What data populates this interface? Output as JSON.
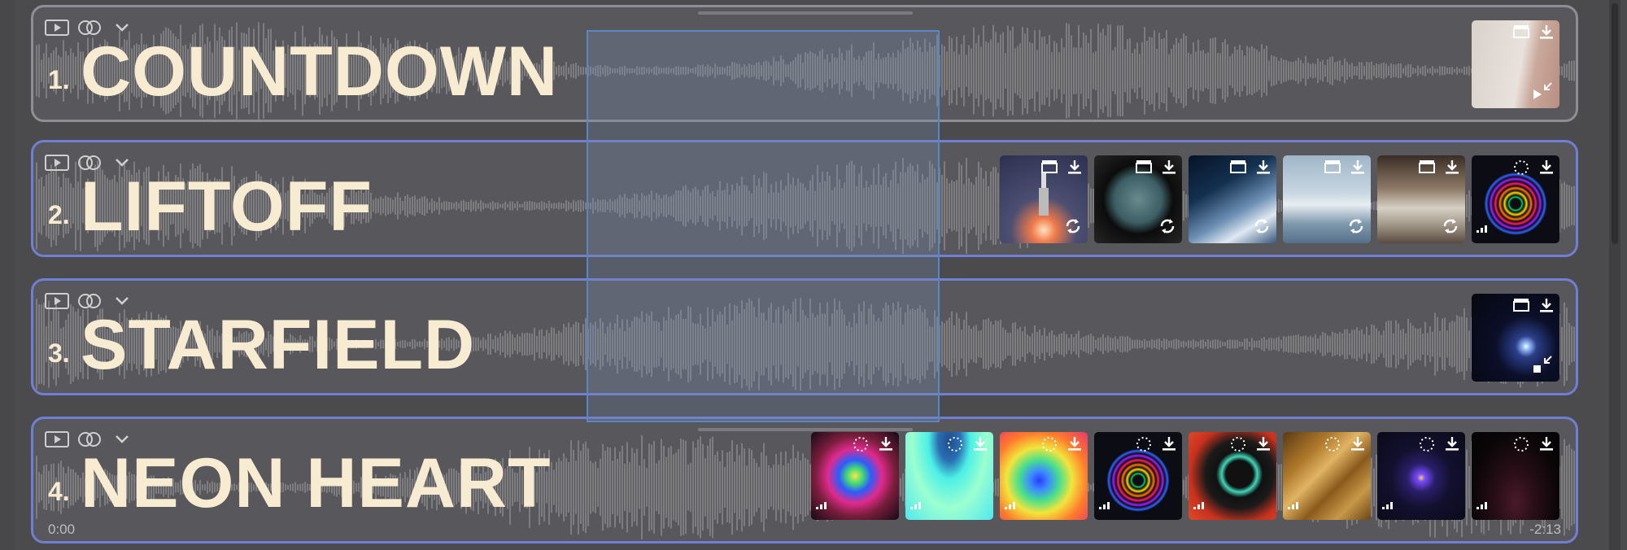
{
  "tracks": [
    {
      "number": "1.",
      "name": "COUNTDOWN",
      "selected": false,
      "thumbnails": [
        {
          "id": "room",
          "icons": [
            "clapper",
            "download",
            "shrink"
          ]
        }
      ]
    },
    {
      "number": "2.",
      "name": "LIFTOFF",
      "selected": true,
      "thumbnails": [
        {
          "id": "rocket",
          "icons": [
            "clapper",
            "download",
            "loop"
          ]
        },
        {
          "id": "porthole",
          "icons": [
            "clapper",
            "download",
            "loop"
          ]
        },
        {
          "id": "earth",
          "icons": [
            "clapper",
            "download",
            "loop"
          ]
        },
        {
          "id": "clouds",
          "icons": [
            "clapper",
            "download",
            "loop"
          ]
        },
        {
          "id": "control-room",
          "icons": [
            "clapper",
            "download",
            "loop"
          ]
        },
        {
          "id": "rainbow-rings",
          "icons": [
            "sparkle",
            "download",
            "signal"
          ]
        }
      ]
    },
    {
      "number": "3.",
      "name": "STARFIELD",
      "selected": true,
      "thumbnails": [
        {
          "id": "star",
          "icons": [
            "clapper",
            "download",
            "shrink"
          ]
        }
      ]
    },
    {
      "number": "4.",
      "name": "NEON HEART",
      "selected": true,
      "thumbnails": [
        {
          "id": "neon-star",
          "icons": [
            "sparkle",
            "download",
            "signal"
          ]
        },
        {
          "id": "cyan-blob",
          "icons": [
            "sparkle",
            "download",
            "signal"
          ]
        },
        {
          "id": "heat-map",
          "icons": [
            "sparkle",
            "download",
            "signal"
          ]
        },
        {
          "id": "rainbow-rings-2",
          "icons": [
            "sparkle",
            "download",
            "signal"
          ]
        },
        {
          "id": "black-swirl",
          "icons": [
            "sparkle",
            "download",
            "signal"
          ]
        },
        {
          "id": "gold-texture",
          "icons": [
            "sparkle",
            "download",
            "signal"
          ]
        },
        {
          "id": "purple-glow",
          "icons": [
            "sparkle",
            "download",
            "signal"
          ]
        },
        {
          "id": "particles",
          "icons": [
            "sparkle",
            "download",
            "signal"
          ]
        }
      ]
    }
  ],
  "timeline": {
    "start": "0:00",
    "end": "-2:13"
  },
  "colors": {
    "title": "#f7ebd2",
    "selected_border": "#6f7fd3",
    "unselected_border": "#8e8e94",
    "selection": "#5b86c6"
  }
}
